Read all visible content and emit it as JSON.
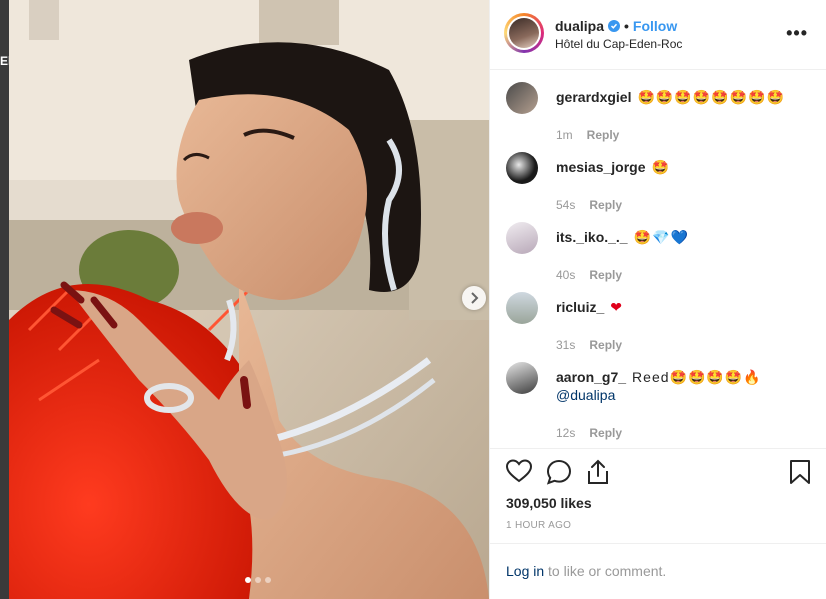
{
  "left_fragment": "El",
  "photo": {
    "carousel_dots": 3,
    "active_dot": 0
  },
  "header": {
    "username": "dualipa",
    "separator": "•",
    "follow_label": "Follow",
    "location": "Hôtel du Cap-Eden-Roc",
    "more_label": "•••"
  },
  "comments": [
    {
      "user": "gerardxgiel",
      "text": "🤩🤩🤩🤩🤩🤩🤩🤩",
      "age": "1m",
      "reply": "Reply"
    },
    {
      "user": "mesias_jorge",
      "text": "🤩",
      "age": "54s",
      "reply": "Reply"
    },
    {
      "user": "its._iko._._",
      "text": "🤩💎💙",
      "age": "40s",
      "reply": "Reply"
    },
    {
      "user": "ricluiz_",
      "text": "❤",
      "age": "31s",
      "reply": "Reply"
    },
    {
      "user": "aaron_g7_",
      "text": "Reed🤩🤩🤩🤩🔥",
      "mention": "@dualipa",
      "age": "12s",
      "reply": "Reply"
    }
  ],
  "likes": "309,050 likes",
  "time": "1 HOUR AGO",
  "login": {
    "link": "Log in",
    "rest": " to like or comment."
  },
  "colors": {
    "accent": "#3897f0",
    "border": "#efefef",
    "muted": "#999999"
  }
}
